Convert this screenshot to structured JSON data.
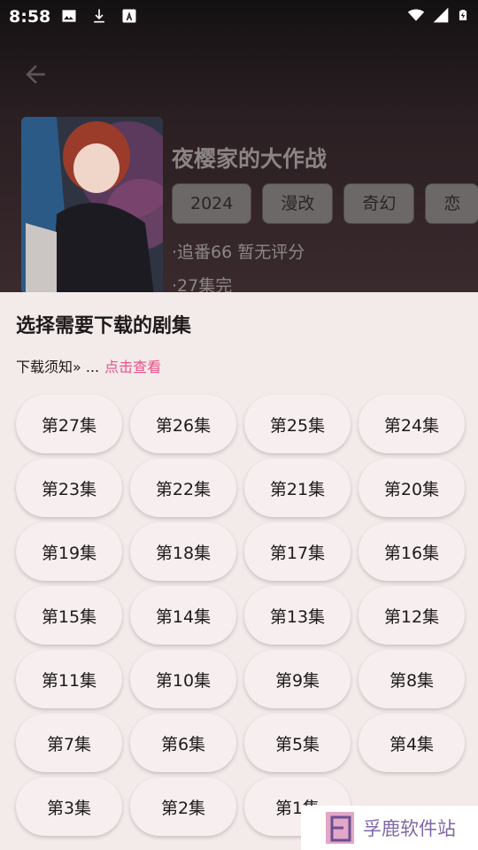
{
  "status": {
    "time": "8:58",
    "icons_left": [
      "image-icon",
      "download-icon",
      "font-icon"
    ],
    "icons_right": [
      "wifi-icon",
      "signal-icon",
      "battery-charging-icon"
    ]
  },
  "detail": {
    "title": "夜樱家的大作战",
    "tags": [
      "2024",
      "漫改",
      "奇幻",
      "恋"
    ],
    "meta_line1": "·追番66 暂无评分",
    "meta_line2": "·27集完"
  },
  "sheet": {
    "title": "选择需要下载的剧集",
    "notice_prefix": "下载须知» ...",
    "notice_link": "点击查看",
    "episodes": [
      "第27集",
      "第26集",
      "第25集",
      "第24集",
      "第23集",
      "第22集",
      "第21集",
      "第20集",
      "第19集",
      "第18集",
      "第17集",
      "第16集",
      "第15集",
      "第14集",
      "第13集",
      "第12集",
      "第11集",
      "第10集",
      "第9集",
      "第8集",
      "第7集",
      "第6集",
      "第5集",
      "第4集",
      "第3集",
      "第2集",
      "第1集"
    ]
  },
  "watermark": {
    "text": "孚鹿软件站"
  },
  "colors": {
    "accent": "#e8508c",
    "sheet_bg": "#f3eaea",
    "watermark_text": "#7f68a8"
  }
}
